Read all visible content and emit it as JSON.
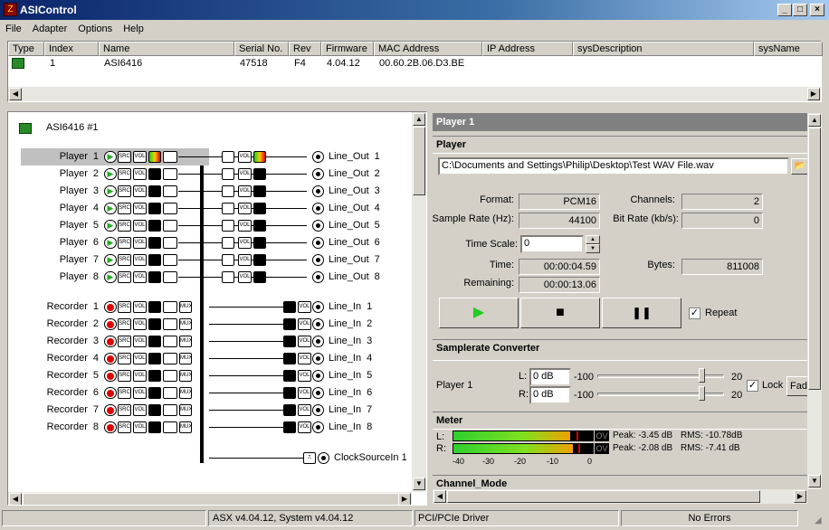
{
  "window": {
    "title": "ASIControl",
    "min": "_",
    "max": "□",
    "close": "×"
  },
  "menu": [
    "File",
    "Adapter",
    "Options",
    "Help"
  ],
  "adapter_table": {
    "columns": [
      "Type",
      "Index",
      "Name",
      "Serial No.",
      "Rev",
      "Firmware",
      "MAC Address",
      "IP Address",
      "sysDescription",
      "sysName"
    ],
    "row": [
      "",
      "1",
      "ASI6416",
      "47518",
      "F4",
      "4.04.12",
      "00.60.2B.06.D3.BE",
      "",
      "",
      ""
    ]
  },
  "tree": {
    "adapter_label": "ASI6416 #1",
    "players": [
      {
        "label": "Player",
        "num": "1",
        "out": "Line_Out",
        "out_num": "1"
      },
      {
        "label": "Player",
        "num": "2",
        "out": "Line_Out",
        "out_num": "2"
      },
      {
        "label": "Player",
        "num": "3",
        "out": "Line_Out",
        "out_num": "3"
      },
      {
        "label": "Player",
        "num": "4",
        "out": "Line_Out",
        "out_num": "4"
      },
      {
        "label": "Player",
        "num": "5",
        "out": "Line_Out",
        "out_num": "5"
      },
      {
        "label": "Player",
        "num": "6",
        "out": "Line_Out",
        "out_num": "6"
      },
      {
        "label": "Player",
        "num": "7",
        "out": "Line_Out",
        "out_num": "7"
      },
      {
        "label": "Player",
        "num": "8",
        "out": "Line_Out",
        "out_num": "8"
      }
    ],
    "recorders": [
      {
        "label": "Recorder",
        "num": "1",
        "in": "Line_In",
        "in_num": "1"
      },
      {
        "label": "Recorder",
        "num": "2",
        "in": "Line_In",
        "in_num": "2"
      },
      {
        "label": "Recorder",
        "num": "3",
        "in": "Line_In",
        "in_num": "3"
      },
      {
        "label": "Recorder",
        "num": "4",
        "in": "Line_In",
        "in_num": "4"
      },
      {
        "label": "Recorder",
        "num": "5",
        "in": "Line_In",
        "in_num": "5"
      },
      {
        "label": "Recorder",
        "num": "6",
        "in": "Line_In",
        "in_num": "6"
      },
      {
        "label": "Recorder",
        "num": "7",
        "in": "Line_In",
        "in_num": "7"
      },
      {
        "label": "Recorder",
        "num": "8",
        "in": "Line_In",
        "in_num": "8"
      }
    ],
    "clock": {
      "label": "ClockSourceIn",
      "num": "1"
    },
    "icon_src": "SRC",
    "icon_vol": "VOL",
    "icon_mux": "MUX",
    "play_glyph": "▶"
  },
  "panel": {
    "title": "Player  1",
    "player_section": "Player",
    "file_path": "C:\\Documents and Settings\\Philip\\Desktop\\Test WAV File.wav",
    "format_label": "Format:",
    "format": "PCM16",
    "channels_label": "Channels:",
    "channels": "2",
    "samplerate_label": "Sample Rate (Hz):",
    "samplerate": "44100",
    "bitrate_label": "Bit Rate (kb/s):",
    "bitrate": "0",
    "timescale_label": "Time Scale:",
    "timescale": "0",
    "time_label": "Time:",
    "time": "00:00:04.59",
    "bytes_label": "Bytes:",
    "bytes": "811008",
    "remaining_label": "Remaining:",
    "remaining": "00:00:13.06",
    "play_glyph": "▶",
    "stop_glyph": "■",
    "pause_glyph": "❚❚",
    "repeat_label": "Repeat",
    "repeat_check": "✓",
    "src_section": "Samplerate Converter",
    "src_player": "Player  1",
    "L_label": "L:",
    "L_value": "0 dB",
    "L_min": "-100",
    "L_max": "20",
    "R_label": "R:",
    "R_value": "0 dB",
    "R_min": "-100",
    "R_max": "20",
    "lock_label": "Lock",
    "lock_check": "✓",
    "fade_label": "Fade",
    "meter_section": "Meter",
    "meter_L_label": "L:",
    "meter_R_label": "R:",
    "ov_label": "OV",
    "peak_L": "Peak: -3.45 dB",
    "rms_L": "RMS: -10.78dB",
    "peak_R": "Peak: -2.08 dB",
    "rms_R": "RMS: -7.41 dB",
    "meter_level_L": 0.84,
    "meter_level_R": 0.86,
    "scale": [
      "-40",
      "-30",
      "-20",
      "-10",
      "0"
    ],
    "channel_section": "Channel_Mode"
  },
  "status": {
    "version": "ASX v4.04.12, System v4.04.12",
    "driver": "PCI/PCIe Driver",
    "errors": "No Errors"
  },
  "colors": {
    "title_start": "#0a246a",
    "title_end": "#a6caf0",
    "meter_green": "#2ed02e",
    "meter_orange": "#f0a000"
  }
}
